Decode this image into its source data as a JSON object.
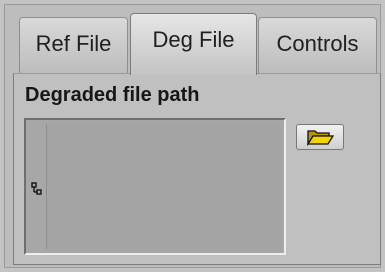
{
  "tabs": [
    {
      "label": "Ref File",
      "active": false
    },
    {
      "label": "Deg File",
      "active": true
    },
    {
      "label": "Controls",
      "active": false
    }
  ],
  "panel": {
    "field_label": "Degraded file path",
    "path_value": "",
    "browse_icon": "folder-open-icon",
    "path_status_icon": "path-status-icon"
  },
  "colors": {
    "folder_yellow": "#f2d400",
    "background": "#c3c3c3"
  }
}
